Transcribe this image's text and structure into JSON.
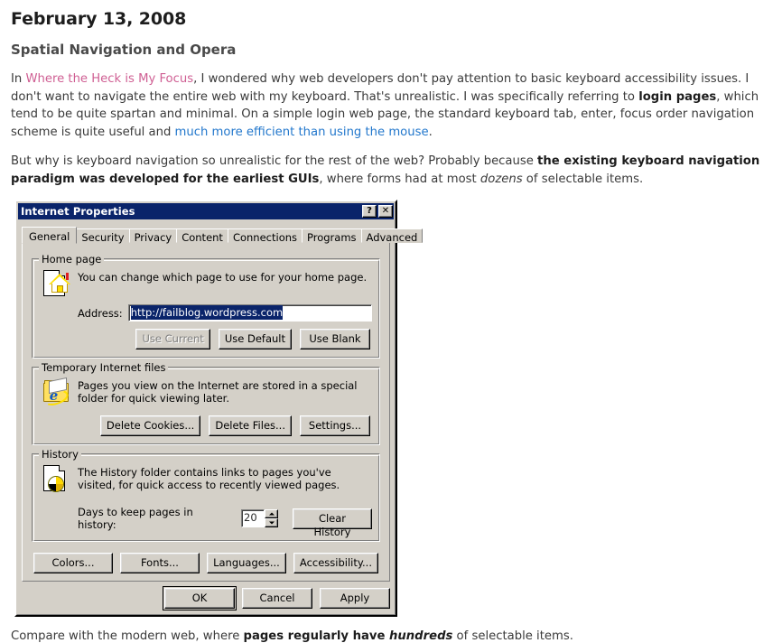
{
  "post": {
    "date": "February 13, 2008",
    "title": "Spatial Navigation and Opera",
    "para1": {
      "lead": "In ",
      "link1": "Where the Heck is My Focus",
      "mid1": ", I wondered why web developers don't pay attention to basic keyboard accessibility issues. I don't want to navigate the entire web with my keyboard. That's unrealistic. I was specifically referring to ",
      "bold1": "login pages",
      "mid2": ", which tend to be quite spartan and minimal. On a simple login web page, the standard keyboard tab, enter, focus order navigation scheme is quite useful and ",
      "link2": "much more efficient than using the mouse",
      "tail": "."
    },
    "para2": {
      "lead": "But why is keyboard navigation so unrealistic for the rest of the web? Probably because ",
      "bold1": "the existing keyboard navigation paradigm was developed for the earliest GUIs",
      "mid": ", where forms had at most ",
      "italic": "dozens",
      "tail": " of selectable items."
    },
    "closing": {
      "lead": "Compare with the modern web, where ",
      "bold": "pages regularly have ",
      "italic": "hundreds",
      "tail": " of selectable items."
    }
  },
  "dialog": {
    "title": "Internet Properties",
    "help_button": "?",
    "close_button": "✕",
    "tabs": [
      {
        "label": "General",
        "active": true
      },
      {
        "label": "Security",
        "active": false
      },
      {
        "label": "Privacy",
        "active": false
      },
      {
        "label": "Content",
        "active": false
      },
      {
        "label": "Connections",
        "active": false
      },
      {
        "label": "Programs",
        "active": false
      },
      {
        "label": "Advanced",
        "active": false
      }
    ],
    "home_page": {
      "group_title": "Home page",
      "description": "You can change which page to use for your home page.",
      "address_label": "Address:",
      "address_value": "http://failblog.wordpress.com",
      "buttons": [
        {
          "label": "Use Current",
          "disabled": true
        },
        {
          "label": "Use Default",
          "disabled": false
        },
        {
          "label": "Use Blank",
          "disabled": false
        }
      ]
    },
    "temp_files": {
      "group_title": "Temporary Internet files",
      "description": "Pages you view on the Internet are stored in a special folder for quick viewing later.",
      "buttons": [
        {
          "label": "Delete Cookies..."
        },
        {
          "label": "Delete Files..."
        },
        {
          "label": "Settings..."
        }
      ]
    },
    "history": {
      "group_title": "History",
      "description": "The History folder contains links to pages you've visited, for quick access to recently viewed pages.",
      "days_label": "Days to keep pages in history:",
      "days_value": "20",
      "clear_button": "Clear History"
    },
    "secondary_buttons": [
      {
        "label": "Colors..."
      },
      {
        "label": "Fonts..."
      },
      {
        "label": "Languages..."
      },
      {
        "label": "Accessibility..."
      }
    ],
    "footer_buttons": [
      {
        "label": "OK",
        "default": true
      },
      {
        "label": "Cancel",
        "default": false
      },
      {
        "label": "Apply",
        "default": false
      }
    ],
    "colors": {
      "titlebar": "#0a246a",
      "face": "#d4d0c8",
      "selection": "#0a246a",
      "disabled_text": "#808080"
    }
  }
}
